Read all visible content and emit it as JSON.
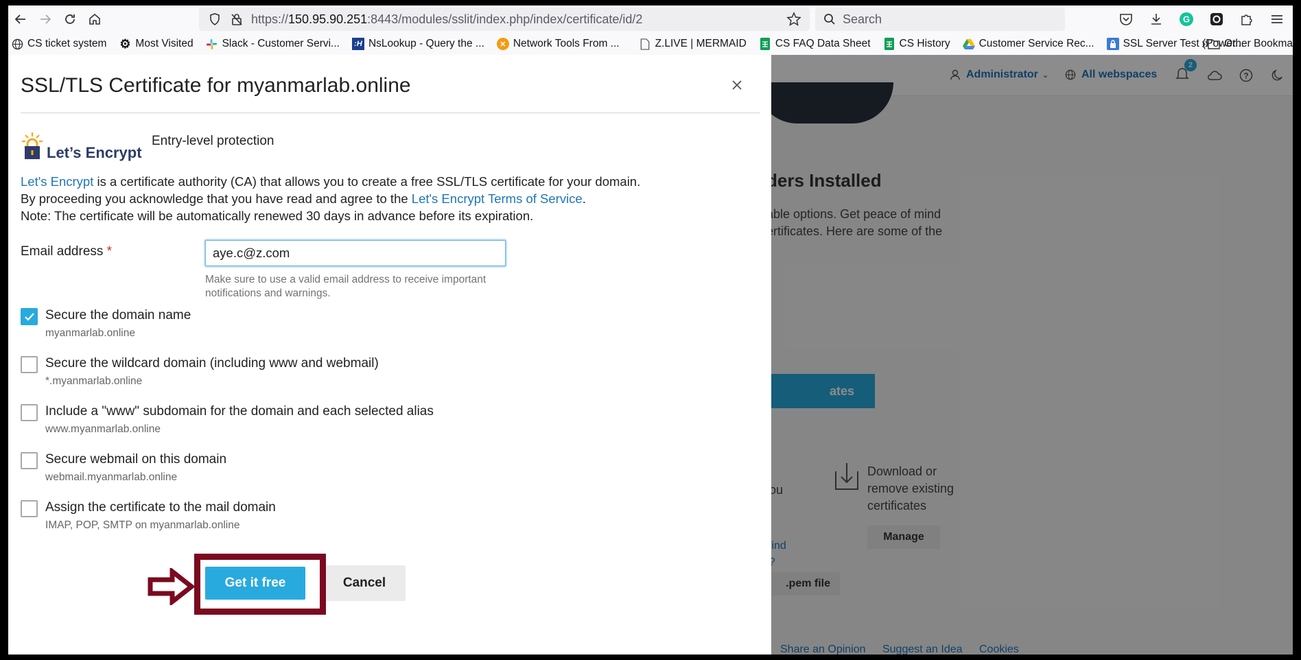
{
  "browser": {
    "url_prefix": "https://",
    "url_host": "150.95.90.251",
    "url_rest": ":8443/modules/sslit/index.php/index/certificate/id/2",
    "search_placeholder": "Search",
    "bookmarks": [
      {
        "label": "CS ticket system",
        "icon": "globe-icon"
      },
      {
        "label": "Most Visited",
        "icon": "gear-icon"
      },
      {
        "label": "Slack - Customer Servi...",
        "icon": "slack-icon"
      },
      {
        "label": "NsLookup - Query the ...",
        "icon": "nslookup-icon"
      },
      {
        "label": "Network Tools From ...",
        "icon": "network-tools-icon"
      },
      {
        "label": "Z.LIVE | MERMAID",
        "icon": "doc-icon"
      },
      {
        "label": "CS FAQ Data Sheet",
        "icon": "sheets-icon"
      },
      {
        "label": "CS History",
        "icon": "sheets-icon"
      },
      {
        "label": "Customer Service Rec...",
        "icon": "drive-icon"
      },
      {
        "label": "SSL Server Test (Power...",
        "icon": "lock-icon"
      }
    ],
    "other_bookmarks": "Other Bookma"
  },
  "background_page": {
    "admin_label": "Administrator",
    "webspaces_label": "All webspaces",
    "notification_count": "2",
    "heading_fragment": "ders Installed",
    "para_line1": "able options. Get peace of mind",
    "para_line2": "ertificates. Here are some of the",
    "blue_button_fragment": "ates",
    "download_text": "Download or remove existing certificates",
    "manage_label": "Manage",
    "frag_you": "you",
    "frag_d": "d",
    "frag_find": "l find",
    "frag_e": "e?",
    "pem_fragment": ".pem file",
    "footer_links": [
      "Share an Opinion",
      "Suggest an Idea",
      "Cookies"
    ]
  },
  "modal": {
    "title": "SSL/TLS Certificate for myanmarlab.online",
    "logo_text": "Let’s Encrypt",
    "provider_title": "Entry-level protection",
    "desc_line1_link": "Let's Encrypt",
    "desc_line1_rest": " is a certificate authority (CA) that allows you to create a free SSL/TLS certificate for your domain.",
    "desc_line2_pre": "By proceeding you acknowledge that you have read and agree to the ",
    "desc_line2_link": "Let's Encrypt Terms of Service",
    "desc_line2_post": ".",
    "desc_line3": "Note: The certificate will be automatically renewed 30 days in advance before its expiration.",
    "email_label": "Email address",
    "email_required_mark": "*",
    "email_value": "aye.c@z.com",
    "email_hint": "Make sure to use a valid email address to receive important notifications and warnings.",
    "options": [
      {
        "label": "Secure the domain name",
        "sub": "myanmarlab.online",
        "checked": true
      },
      {
        "label": "Secure the wildcard domain (including www and webmail)",
        "sub": "*.myanmarlab.online",
        "checked": false
      },
      {
        "label": "Include a \"www\" subdomain for the domain and each selected alias",
        "sub": "www.myanmarlab.online",
        "checked": false
      },
      {
        "label": "Secure webmail on this domain",
        "sub": "webmail.myanmarlab.online",
        "checked": false
      },
      {
        "label": "Assign the certificate to the mail domain",
        "sub": "IMAP, POP, SMTP on myanmarlab.online",
        "checked": false
      }
    ],
    "submit_label": "Get it free",
    "cancel_label": "Cancel"
  },
  "colors": {
    "accent": "#28aade",
    "link": "#1e75b9",
    "highlight": "#7b0a1f"
  }
}
